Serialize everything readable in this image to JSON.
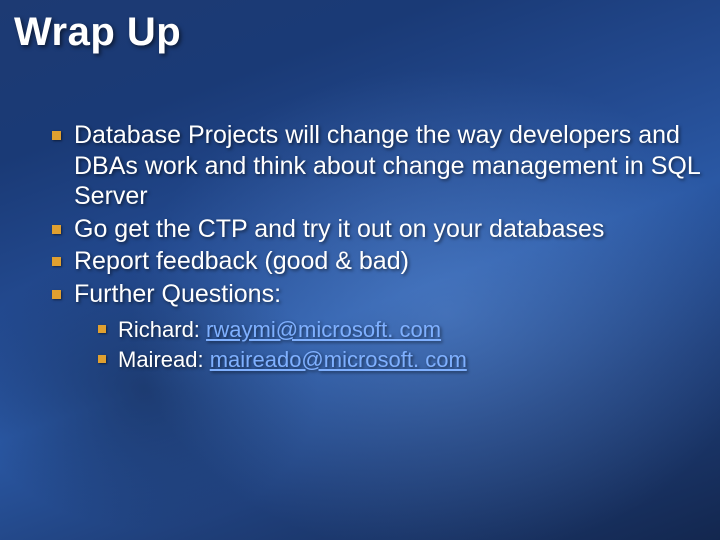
{
  "title": "Wrap Up",
  "bullets": {
    "b0": "Database Projects will change the way developers and DBAs work and think about change management in SQL Server",
    "b1": "Go get the CTP and try it out on your databases",
    "b2": "Report feedback (good & bad)",
    "b3": "Further Questions:"
  },
  "contacts": {
    "c0": {
      "label": "Richard: ",
      "email": "rwaymi@microsoft. com"
    },
    "c1": {
      "label": "Mairead: ",
      "email": "maireado@microsoft. com"
    }
  }
}
